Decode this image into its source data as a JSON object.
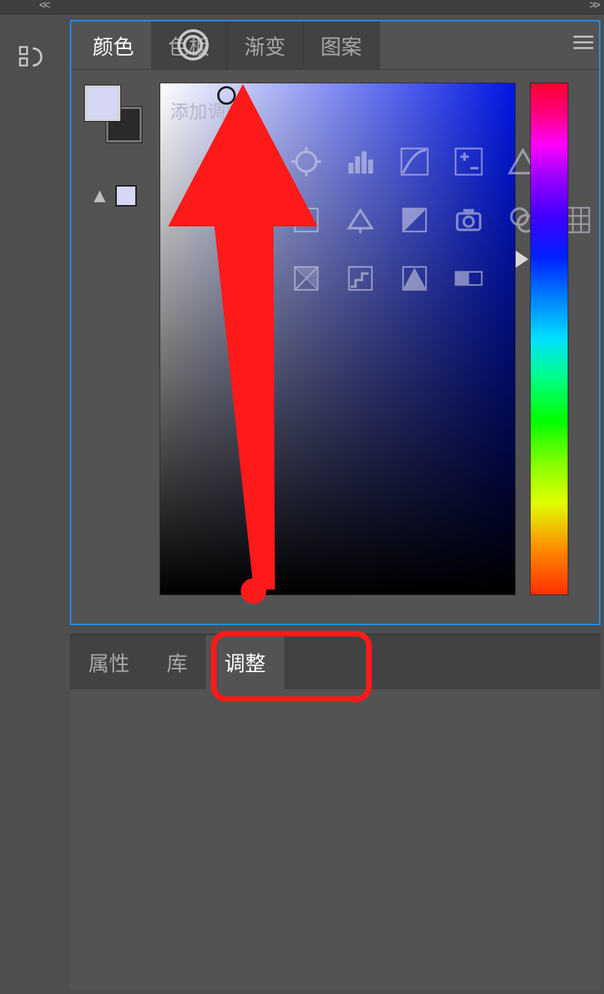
{
  "topbar": {
    "chev_left": "<<",
    "chev_right": ">>"
  },
  "color_panel": {
    "tabs": [
      {
        "label": "颜色",
        "active": true
      },
      {
        "label": "色板",
        "active": false
      },
      {
        "label": "渐变",
        "active": false
      },
      {
        "label": "图案",
        "active": false
      }
    ],
    "fg_color": "#d6d7f2",
    "bg_color": "#2a2a2a",
    "overlay_label": "添加调整",
    "adjustment_icons": [
      [
        "brightness-contrast-icon",
        "levels-icon",
        "curves-icon",
        "exposure-icon",
        "vibrance-icon"
      ],
      [
        "hue-saturation-icon",
        "color-balance-icon",
        "black-white-icon",
        "photo-filter-icon",
        "channel-mixer-icon",
        "color-lookup-icon"
      ],
      [
        "invert-icon",
        "posterize-icon",
        "threshold-icon",
        "gradient-map-icon"
      ]
    ]
  },
  "lower_panel": {
    "tabs": [
      {
        "label": "属性",
        "active": false
      },
      {
        "label": "库",
        "active": false
      },
      {
        "label": "调整",
        "active": true
      }
    ]
  },
  "annotation": {
    "arrow_color": "#ff1a1a",
    "highlight_color": "#ff1a1a"
  }
}
